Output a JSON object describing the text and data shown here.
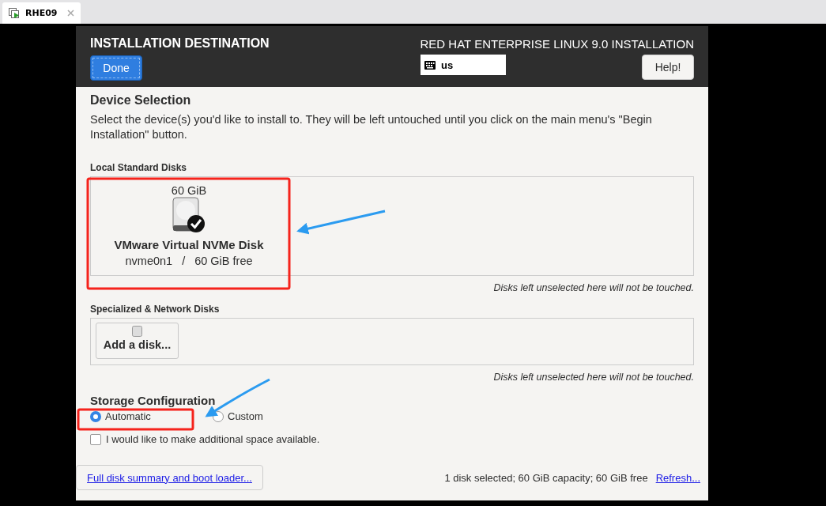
{
  "vm_tab": {
    "title": "RHE09"
  },
  "header": {
    "title": "INSTALLATION DESTINATION",
    "done_button": "Done",
    "product": "RED HAT ENTERPRISE LINUX 9.0 INSTALLATION",
    "keyboard_layout": "us",
    "help_button": "Help!"
  },
  "device_selection": {
    "heading": "Device Selection",
    "description": "Select the device(s) you'd like to install to.  They will be left untouched until you click on the main menu's \"Begin Installation\" button."
  },
  "local_disks": {
    "heading": "Local Standard Disks",
    "disks": [
      {
        "size": "60 GiB",
        "name": "VMware Virtual NVMe Disk",
        "device": "nvme0n1",
        "separator": "/",
        "free": "60 GiB free",
        "selected": true
      }
    ],
    "note": "Disks left unselected here will not be touched."
  },
  "network_disks": {
    "heading": "Specialized & Network Disks",
    "add_button": "Add a disk...",
    "note": "Disks left unselected here will not be touched."
  },
  "storage_configuration": {
    "heading": "Storage Configuration",
    "options": [
      {
        "label": "Automatic",
        "selected": true
      },
      {
        "label": "Custom",
        "selected": false
      }
    ],
    "extra_space": {
      "label": "I would like to make additional space available.",
      "checked": false
    }
  },
  "footer": {
    "summary_link": "Full disk summary and boot loader...",
    "status": "1 disk selected; 60 GiB capacity; 60 GiB free",
    "refresh_link": "Refresh..."
  }
}
